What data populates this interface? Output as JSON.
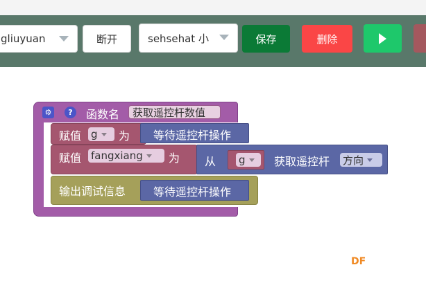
{
  "toolbar": {
    "device_select": {
      "value": "gliuyuan"
    },
    "disconnect_label": "断开",
    "program_select": {
      "value": "sehsehat 小"
    },
    "save_label": "保存",
    "delete_label": "删除",
    "colors": {
      "bar": "#59786a",
      "save": "#0b7a36",
      "delete": "#fa4646",
      "run": "#1ec86b"
    }
  },
  "blocks": {
    "function": {
      "header_label": "函数名",
      "name": "获取遥控杆数值",
      "color": "#a35ca8"
    },
    "assign1": {
      "label": "赋值",
      "variable": "g",
      "to": "为",
      "color": "#a5566f"
    },
    "wait1": {
      "label": "等待遥控杆操作",
      "color": "#5b67a5"
    },
    "assign2": {
      "label": "赋值",
      "variable": "fangxiang",
      "to": "为"
    },
    "from": {
      "label": "从",
      "source": "g",
      "action": "获取遥控杆",
      "property": "方向"
    },
    "debug": {
      "label": "输出调试信息",
      "color": "#a5a05a"
    },
    "wait2": {
      "label": "等待遥控杆操作"
    }
  },
  "watermark": {
    "text": "DF"
  }
}
